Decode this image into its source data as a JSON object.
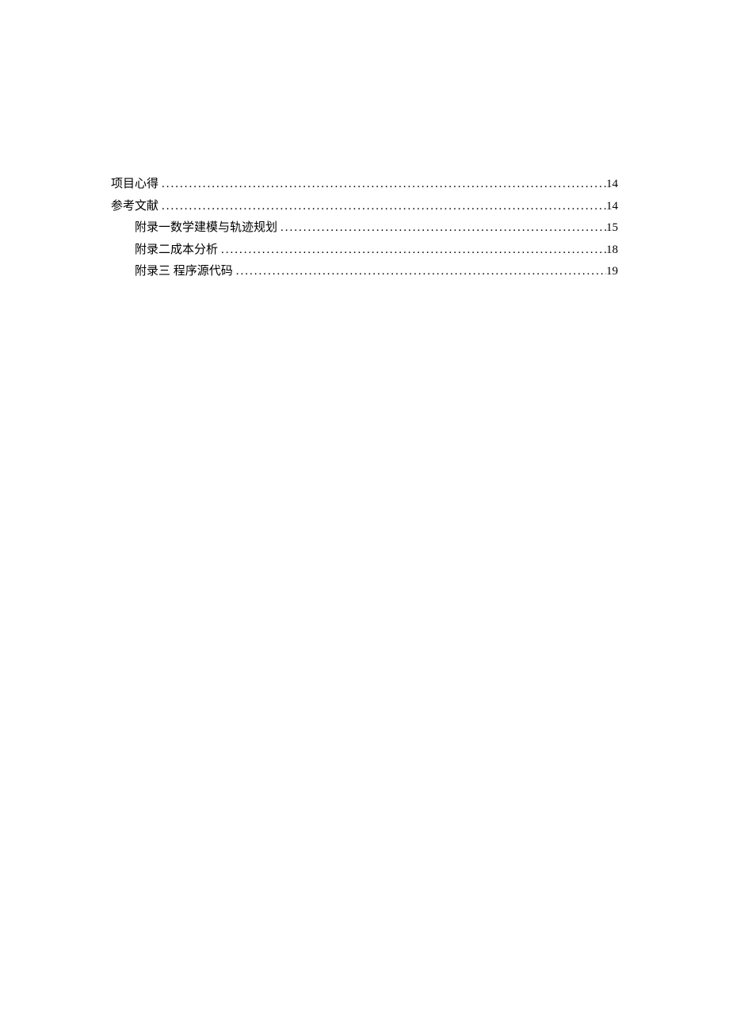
{
  "toc": {
    "entries": [
      {
        "level": 1,
        "label": "项目心得",
        "page": "14"
      },
      {
        "level": 1,
        "label": "参考文献",
        "page": "14"
      },
      {
        "level": 2,
        "label": "附录一数学建模与轨迹规划",
        "page": "15"
      },
      {
        "level": 2,
        "label": "附录二成本分析",
        "page": "18"
      },
      {
        "level": 2,
        "label": "附录三  程序源代码",
        "page": "19"
      }
    ]
  }
}
